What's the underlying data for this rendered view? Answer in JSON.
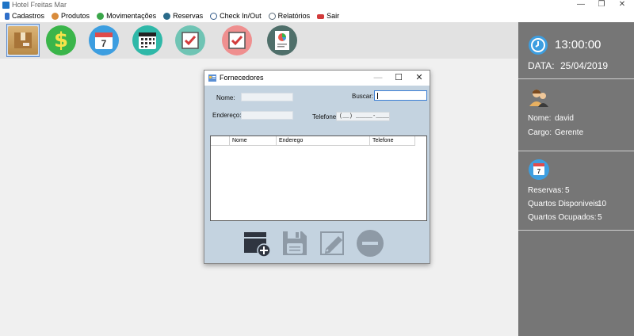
{
  "window": {
    "title": "Hotel Freitas Mar",
    "minimize": "—",
    "maximize": "❐",
    "close": "✕"
  },
  "menu": [
    {
      "label": "Cadastros",
      "icon": "document-icon",
      "color": "#2f6fc9"
    },
    {
      "label": "Produtos",
      "icon": "products-icon",
      "color": "#d98c3c"
    },
    {
      "label": "Movimentações",
      "icon": "money-icon",
      "color": "#3aa64a"
    },
    {
      "label": "Reservas",
      "icon": "reservations-icon",
      "color": "#2a6b8a"
    },
    {
      "label": "Check In/Out",
      "icon": "checkin-icon",
      "color": "#355c8a"
    },
    {
      "label": "Relatórios",
      "icon": "reports-icon",
      "color": "#5a6b7a"
    },
    {
      "label": "Sair",
      "icon": "exit-icon",
      "color": "#d23b3b"
    }
  ],
  "toolbar": [
    {
      "icon": "box-icon",
      "color": "#c8a060",
      "selected": true
    },
    {
      "icon": "dollar-icon",
      "color": "#3ab54a"
    },
    {
      "icon": "calendar-day-icon",
      "color": "#3d9ee0",
      "text": "7"
    },
    {
      "icon": "calendar-month-icon",
      "color": "#2fb8a8"
    },
    {
      "icon": "checkbox-teal-icon",
      "color": "#6fc4b4"
    },
    {
      "icon": "checkbox-red-icon",
      "color": "#ef8f8f"
    },
    {
      "icon": "report-icon",
      "color": "#4f6f6a"
    }
  ],
  "panel": {
    "time": "13:00:00",
    "date_label": "DATA:",
    "date": "25/04/2019",
    "name_label": "Nome:",
    "name": "david",
    "role_label": "Cargo:",
    "role": "Gerente",
    "calendar_text": "7",
    "reservations_label": "Reservas:",
    "reservations": "5",
    "available_label": "Quartos Disponiveis:",
    "available": "10",
    "occupied_label": "Quartos Ocupados:",
    "occupied": "5"
  },
  "dialog": {
    "title": "Fornecedores",
    "minimize": "—",
    "maximize": "☐",
    "close": "✕",
    "nome_label": "Nome:",
    "endereco_label": "Endereço:",
    "buscar_label": "Buscar:",
    "telefone_label": "Telefone:",
    "telefone_mask": "(__) _____-____",
    "columns": [
      "",
      "Nome",
      "Enderego",
      "Telefone"
    ]
  }
}
